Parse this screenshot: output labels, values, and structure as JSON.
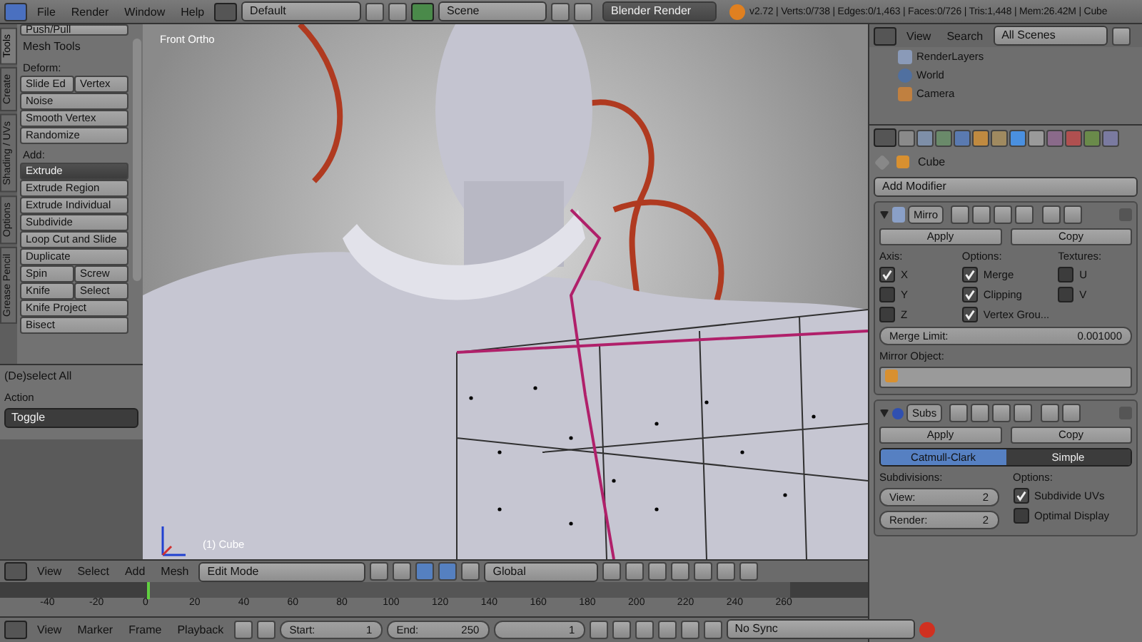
{
  "top_bar": {
    "menus": [
      "File",
      "Render",
      "Window",
      "Help"
    ],
    "screen_layout": "Default",
    "scene": "Scene",
    "render_engine": "Blender Render",
    "stats": "v2.72 | Verts:0/738 | Edges:0/1,463 | Faces:0/726 | Tris:1,448 | Mem:26.42M | Cube"
  },
  "tool_shelf": {
    "tabs": [
      {
        "label": "Tools",
        "selected": true
      },
      {
        "label": "Create",
        "selected": false
      },
      {
        "label": "Shading / UVs",
        "selected": false
      },
      {
        "label": "Options",
        "selected": false
      },
      {
        "label": "Grease Pencil",
        "selected": false
      }
    ],
    "cut_button": "Push/Pull",
    "panel_title": "Mesh Tools",
    "groups": [
      {
        "label": "Deform:",
        "rows": [
          [
            "Slide Ed",
            "Vertex"
          ],
          [
            "Noise"
          ],
          [
            "Smooth Vertex"
          ],
          [
            "Randomize"
          ]
        ]
      },
      {
        "label": "Add:",
        "dropdown": "Extrude",
        "rows": [
          [
            "Extrude Region"
          ],
          [
            "Extrude Individual"
          ],
          [
            "Subdivide"
          ],
          [
            "Loop Cut and Slide"
          ],
          [
            "Duplicate"
          ],
          [
            "Spin",
            "Screw"
          ],
          [
            "Knife",
            "Select"
          ],
          [
            "Knife Project"
          ],
          [
            "Bisect"
          ]
        ]
      }
    ]
  },
  "operator_panel": {
    "title": "(De)select All",
    "field_label": "Action",
    "value": "Toggle"
  },
  "viewport": {
    "view_name": "Front Ortho",
    "object_name": "(1) Cube"
  },
  "viewport_header": {
    "menus": [
      "View",
      "Select",
      "Add",
      "Mesh"
    ],
    "mode": "Edit Mode",
    "orientation": "Global"
  },
  "timeline": {
    "ticks": [
      "-40",
      "-20",
      "0",
      "20",
      "40",
      "60",
      "80",
      "100",
      "120",
      "140",
      "160",
      "180",
      "200",
      "220",
      "240",
      "260"
    ],
    "level": 0.17
  },
  "timeline_header": {
    "menus": [
      "View",
      "Marker",
      "Frame",
      "Playback"
    ],
    "start_label": "Start:",
    "start_value": "1",
    "end_label": "End:",
    "end_value": "250",
    "current_frame": "1",
    "sync": "No Sync"
  },
  "outliner": {
    "menus": [
      "View",
      "Search"
    ],
    "filter": "All Scenes",
    "items": [
      {
        "label": "RenderLayers",
        "kind": "render-layers"
      },
      {
        "label": "World",
        "kind": "world"
      },
      {
        "label": "Camera",
        "kind": "camera"
      }
    ]
  },
  "properties": {
    "object": "Cube",
    "add_modifier": "Add Modifier",
    "modifiers": [
      {
        "kind": "mirror",
        "name": "Mirro",
        "apply": "Apply",
        "copy": "Copy",
        "columns": [
          {
            "label": "Axis:",
            "options": [
              {
                "label": "X",
                "checked": true
              },
              {
                "label": "Y",
                "checked": false
              },
              {
                "label": "Z",
                "checked": false
              }
            ]
          },
          {
            "label": "Options:",
            "options": [
              {
                "label": "Merge",
                "checked": true
              },
              {
                "label": "Clipping",
                "checked": true
              },
              {
                "label": "Vertex Grou...",
                "checked": true
              }
            ]
          },
          {
            "label": "Textures:",
            "options": [
              {
                "label": "U",
                "checked": false
              },
              {
                "label": "V",
                "checked": false
              }
            ]
          }
        ],
        "limit_label": "Merge Limit:",
        "limit_value": "0.001000",
        "object_label": "Mirror Object:"
      },
      {
        "kind": "subsurf",
        "name": "Subs",
        "apply": "Apply",
        "copy": "Copy",
        "types": [
          {
            "label": "Catmull-Clark",
            "selected": true
          },
          {
            "label": "Simple",
            "selected": false
          }
        ],
        "levels_label": "Subdivisions:",
        "levels": [
          {
            "label": "View:",
            "value": "2"
          },
          {
            "label": "Render:",
            "value": "2"
          }
        ],
        "options_label": "Options:",
        "options": [
          {
            "label": "Subdivide UVs",
            "checked": true
          },
          {
            "label": "Optimal Display",
            "checked": false
          }
        ]
      }
    ]
  }
}
